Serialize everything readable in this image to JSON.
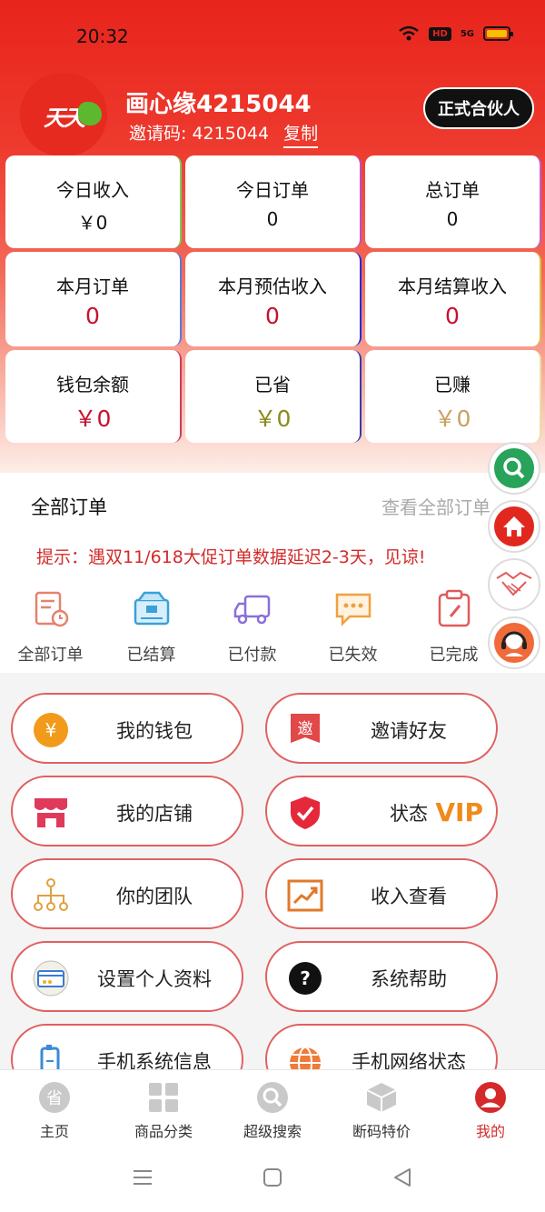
{
  "status_bar": {
    "time": "20:32",
    "hd": "HD",
    "net": "5G"
  },
  "profile": {
    "avatar_text": "天天",
    "username": "画心缘4215044",
    "invite_label": "邀请码: 4215044",
    "copy_label": "复制",
    "partner_button": "正式合伙人"
  },
  "stats": [
    {
      "label": "今日收入",
      "value": "￥0"
    },
    {
      "label": "今日订单",
      "value": "0"
    },
    {
      "label": "总订单",
      "value": "0"
    },
    {
      "label": "本月订单",
      "value": "0"
    },
    {
      "label": "本月预估收入",
      "value": "0"
    },
    {
      "label": "本月结算收入",
      "value": "0"
    },
    {
      "label": "钱包余额",
      "value": "￥0"
    },
    {
      "label": "已省",
      "value": "￥0"
    },
    {
      "label": "已赚",
      "value": "￥0"
    }
  ],
  "orders": {
    "title": "全部订单",
    "view_all": "查看全部订单",
    "notice": "提示：遇双11/618大促订单数据延迟2-3天，见谅!",
    "items": [
      {
        "label": "全部订单",
        "icon": "order-list-icon"
      },
      {
        "label": "已结算",
        "icon": "settled-box-icon"
      },
      {
        "label": "已付款",
        "icon": "delivery-truck-icon"
      },
      {
        "label": "已失效",
        "icon": "chat-bubble-icon"
      },
      {
        "label": "已完成",
        "icon": "clipboard-icon"
      }
    ]
  },
  "menu": [
    {
      "label": "我的钱包",
      "icon": "yuan-wallet-icon"
    },
    {
      "label": "邀请好友",
      "icon": "invite-tag-icon"
    },
    {
      "label": "我的店铺",
      "icon": "shop-icon"
    },
    {
      "label": "状态",
      "icon": "shield-check-icon",
      "badge": "VIP"
    },
    {
      "label": "你的团队",
      "icon": "team-tree-icon"
    },
    {
      "label": "收入查看",
      "icon": "trend-chart-icon"
    },
    {
      "label": "设置个人资料",
      "icon": "card-icon"
    },
    {
      "label": "系统帮助",
      "icon": "help-icon"
    },
    {
      "label": "手机系统信息",
      "icon": "phone-icon"
    },
    {
      "label": "手机网络状态",
      "icon": "globe-icon"
    }
  ],
  "tabs": [
    {
      "label": "主页",
      "icon": "home-save-icon"
    },
    {
      "label": "商品分类",
      "icon": "grid-icon"
    },
    {
      "label": "超级搜索",
      "icon": "search-icon"
    },
    {
      "label": "断码特价",
      "icon": "box-icon"
    },
    {
      "label": "我的",
      "icon": "user-icon"
    }
  ],
  "colors": {
    "brand_red": "#e8241c",
    "accent_red": "#d42a2a",
    "vip": "#f08a1a"
  }
}
